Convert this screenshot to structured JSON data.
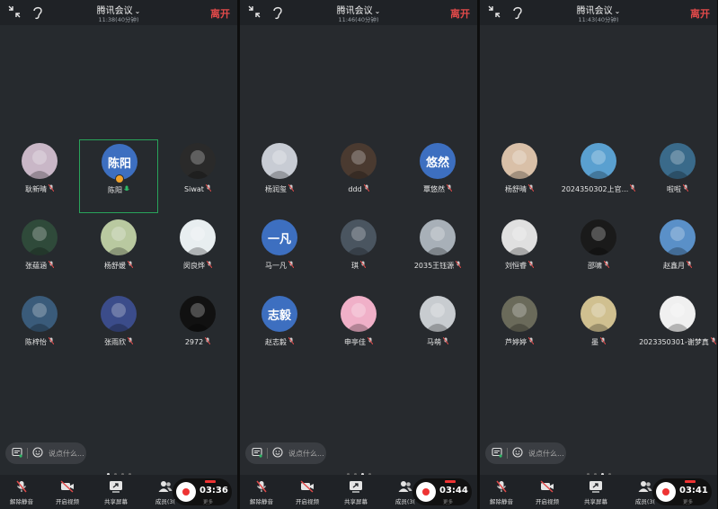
{
  "screens": [
    {
      "title": "腾讯会议",
      "subtitle": "11:38(40分钟)",
      "leave": "离开",
      "participants": [
        {
          "name": "耿新晴",
          "initials": "",
          "color": "#c9b7c7",
          "mic": "muted"
        },
        {
          "name": "陈阳",
          "initials": "陈阳",
          "color": "#3d6fc0",
          "mic": "on",
          "active": true,
          "host": true
        },
        {
          "name": "Siwat",
          "initials": "",
          "color": "#2a2a2a",
          "mic": "muted"
        },
        {
          "name": "张蕴涵",
          "initials": "",
          "color": "#2f4a3a",
          "mic": "muted"
        },
        {
          "name": "杨舒媛",
          "initials": "",
          "color": "#b9c9a0",
          "mic": "muted"
        },
        {
          "name": "闵良烨",
          "initials": "",
          "color": "#e8eef0",
          "mic": "muted"
        },
        {
          "name": "陈梓怡",
          "initials": "",
          "color": "#3a5b7a",
          "mic": "muted"
        },
        {
          "name": "张雨欣",
          "initials": "",
          "color": "#3b4c8a",
          "mic": "muted"
        },
        {
          "name": "2972",
          "initials": "",
          "color": "#111111",
          "mic": "muted"
        }
      ],
      "chat_placeholder": "说点什么...",
      "page_index": 0,
      "record_time": "03:36"
    },
    {
      "title": "腾讯会议",
      "subtitle": "11:46(40分钟)",
      "leave": "离开",
      "participants": [
        {
          "name": "杨润玺",
          "initials": "",
          "color": "#c8ccd4",
          "mic": "muted"
        },
        {
          "name": "ddd",
          "initials": "",
          "color": "#4a3a30",
          "mic": "muted"
        },
        {
          "name": "覃悠然",
          "initials": "悠然",
          "color": "#3d6fc0",
          "mic": "muted"
        },
        {
          "name": "马一凡",
          "initials": "一凡",
          "color": "#3d6fc0",
          "mic": "muted"
        },
        {
          "name": "琪",
          "initials": "",
          "color": "#4a5560",
          "mic": "muted"
        },
        {
          "name": "2035王钰源",
          "initials": "",
          "color": "#a8b0b8",
          "mic": "muted"
        },
        {
          "name": "赵志毅",
          "initials": "志毅",
          "color": "#3d6fc0",
          "mic": "muted"
        },
        {
          "name": "申亭佳",
          "initials": "",
          "color": "#f0b0c8",
          "mic": "muted"
        },
        {
          "name": "马萌",
          "initials": "",
          "color": "#c8ccd0",
          "mic": "muted"
        }
      ],
      "chat_placeholder": "说点什么...",
      "page_index": 2,
      "record_time": "03:44"
    },
    {
      "title": "腾讯会议",
      "subtitle": "11:43(40分钟)",
      "leave": "离开",
      "participants": [
        {
          "name": "杨舒晴",
          "initials": "",
          "color": "#d9c0a8",
          "mic": "muted"
        },
        {
          "name": "2024350302上官...",
          "initials": "",
          "color": "#5aa0d0",
          "mic": "muted"
        },
        {
          "name": "啦啦",
          "initials": "",
          "color": "#3a6a8a",
          "mic": "muted"
        },
        {
          "name": "刘恒睿",
          "initials": "",
          "color": "#e0e0e0",
          "mic": "muted"
        },
        {
          "name": "邵啸",
          "initials": "",
          "color": "#1a1a1a",
          "mic": "muted"
        },
        {
          "name": "赵鑫月",
          "initials": "",
          "color": "#5a90c8",
          "mic": "muted"
        },
        {
          "name": "芦婷婷",
          "initials": "",
          "color": "#6a6a5a",
          "mic": "muted"
        },
        {
          "name": "墨",
          "initials": "",
          "color": "#d0c090",
          "mic": "muted"
        },
        {
          "name": "2023350301-谢梦真",
          "initials": "",
          "color": "#f0f0f0",
          "mic": "muted"
        }
      ],
      "chat_placeholder": "说点什么...",
      "page_index": 2,
      "record_time": "03:41"
    }
  ],
  "toolbar": {
    "unmute": "解除静音",
    "video": "开启视频",
    "share": "共享屏幕",
    "members": "成员(3(",
    "more": "更多"
  }
}
